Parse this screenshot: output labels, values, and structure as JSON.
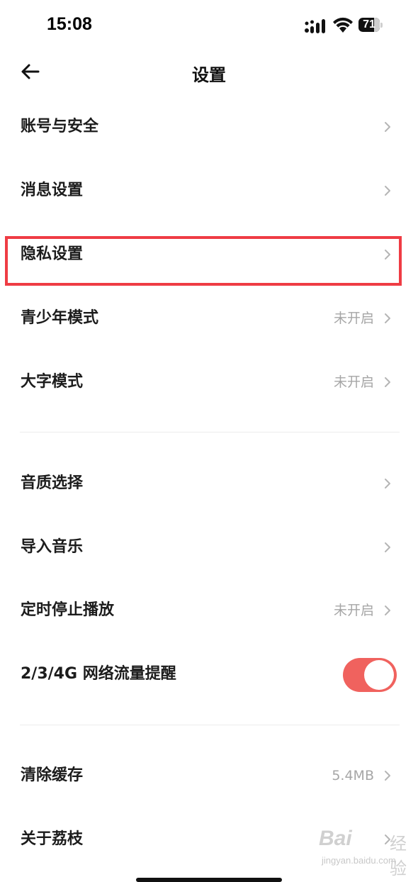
{
  "status_bar": {
    "time": "15:08",
    "battery": "71",
    "battery_level": 0.71
  },
  "nav": {
    "title": "设置",
    "back_icon": "arrow-left-icon"
  },
  "settings": {
    "account": {
      "label": "账号与安全"
    },
    "messages": {
      "label": "消息设置"
    },
    "privacy": {
      "label": "隐私设置",
      "highlighted": true
    },
    "teen_mode": {
      "label": "青少年模式",
      "value": "未开启"
    },
    "large_font": {
      "label": "大字模式",
      "value": "未开启"
    },
    "audio_quality": {
      "label": "音质选择"
    },
    "import_music": {
      "label": "导入音乐"
    },
    "sleep_timer": {
      "label": "定时停止播放",
      "value": "未开启"
    },
    "network_alert": {
      "label": "2/3/4G 网络流量提醒",
      "enabled": true
    },
    "clear_cache": {
      "label": "清除缓存",
      "value": "5.4MB"
    },
    "about": {
      "label": "关于荔枝"
    }
  },
  "watermark": {
    "brand": "Bai",
    "cn": "经验",
    "sub": "jingyan.baidu.com"
  },
  "colors": {
    "highlight": "#ef3c44",
    "toggle_on": "#f0625e",
    "value_text": "#a6a6a6"
  }
}
